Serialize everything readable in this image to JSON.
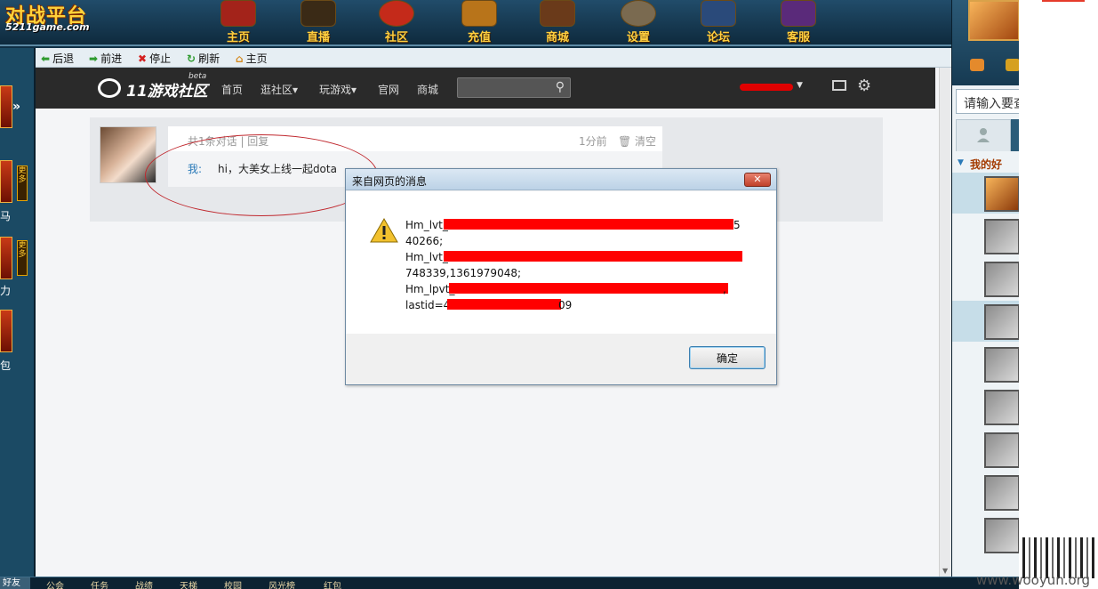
{
  "topnav": {
    "logo_main": "对战平台",
    "logo_sub": "5211game.com",
    "items": [
      {
        "label": "主页",
        "icon": "house-icon",
        "color": "#a3231a"
      },
      {
        "label": "直播",
        "icon": "broadcast-icon",
        "color": "#3a2a16"
      },
      {
        "label": "社区",
        "icon": "community-icon",
        "color": "#c42a1a"
      },
      {
        "label": "充值",
        "icon": "treasure-chest-icon",
        "color": "#b8741a"
      },
      {
        "label": "商城",
        "icon": "shop-icon",
        "color": "#6a3a1a"
      },
      {
        "label": "设置",
        "icon": "gear-icon",
        "color": "#7a6a50"
      },
      {
        "label": "论坛",
        "icon": "forum-icon",
        "color": "#2a4a7a"
      },
      {
        "label": "客服",
        "icon": "support-icon",
        "color": "#5a2a7a"
      }
    ]
  },
  "toolbar": {
    "back": "后退",
    "forward": "前进",
    "stop": "停止",
    "refresh": "刷新",
    "home": "主页"
  },
  "left": {
    "more_label": "更多",
    "texts": [
      "马",
      "力",
      "包"
    ]
  },
  "site": {
    "logo_text": "11游戏社区",
    "logo_beta": "beta",
    "nav": [
      "首页",
      "逛社区▾",
      "玩游戏▾",
      "官网",
      "商城"
    ],
    "search_placeholder": ""
  },
  "thread": {
    "info": "共1条对话 | 回复",
    "time": "1分前",
    "clear": "🗑 清空",
    "me_label": "我:",
    "message": "hi，大美女上线一起dota"
  },
  "dialog": {
    "title": "来自网页的消息",
    "close": "✕",
    "lines": [
      "Hm_lvt_",
      "40266;",
      "Hm_lvt_",
      "748339,1361979048;",
      "Hm_lpvt_",
      "lastid=4",
      "09"
    ],
    "trail_1": "5",
    "trail_2": ",",
    "ok": "确定"
  },
  "right": {
    "search_placeholder": "请输入要查",
    "group": "我的好",
    "group_arrow": "▼"
  },
  "bottom": {
    "start": "好友",
    "items": [
      "公会",
      "任务",
      "战绩",
      "天梯",
      "校园",
      "风光榜",
      "红包"
    ]
  },
  "watermark": "www.wooyun.org"
}
